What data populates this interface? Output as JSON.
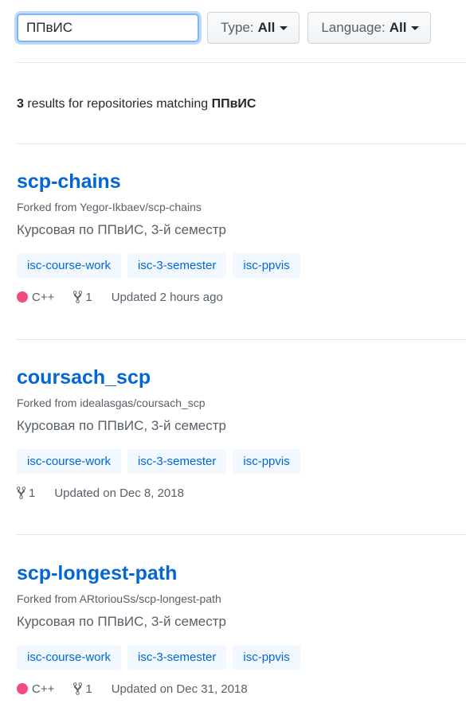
{
  "search": {
    "value": "ППвИС"
  },
  "filters": [
    {
      "label": "Type:",
      "value": "All"
    },
    {
      "label": "Language:",
      "value": "All"
    }
  ],
  "summary": {
    "count": "3",
    "text": " results for repositories matching ",
    "query": "ППвИС"
  },
  "colors": {
    "cpp": "#f34b7d",
    "link": "#0366d6"
  },
  "repos": [
    {
      "name": "scp-chains",
      "forked_prefix": "Forked from ",
      "forked_from": "Yegor-Ikbaev/scp-chains",
      "description": "Курсовая по ППвИС, 3-й семестр",
      "topics": [
        "isc-course-work",
        "isc-3-semester",
        "isc-ppvis"
      ],
      "language": "C++",
      "forks": "1",
      "updated": "Updated 2 hours ago"
    },
    {
      "name": "coursach_scp",
      "forked_prefix": "Forked from ",
      "forked_from": "idealasgas/coursach_scp",
      "description": "Курсовая по ППвИС, 3-й семестр",
      "topics": [
        "isc-course-work",
        "isc-3-semester",
        "isc-ppvis"
      ],
      "language": "",
      "forks": "1",
      "updated": "Updated on Dec 8, 2018"
    },
    {
      "name": "scp-longest-path",
      "forked_prefix": "Forked from ",
      "forked_from": "ARtoriouSs/scp-longest-path",
      "description": "Курсовая по ППвИС, 3-й семестр",
      "topics": [
        "isc-course-work",
        "isc-3-semester",
        "isc-ppvis"
      ],
      "language": "C++",
      "forks": "1",
      "updated": "Updated on Dec 31, 2018"
    }
  ]
}
